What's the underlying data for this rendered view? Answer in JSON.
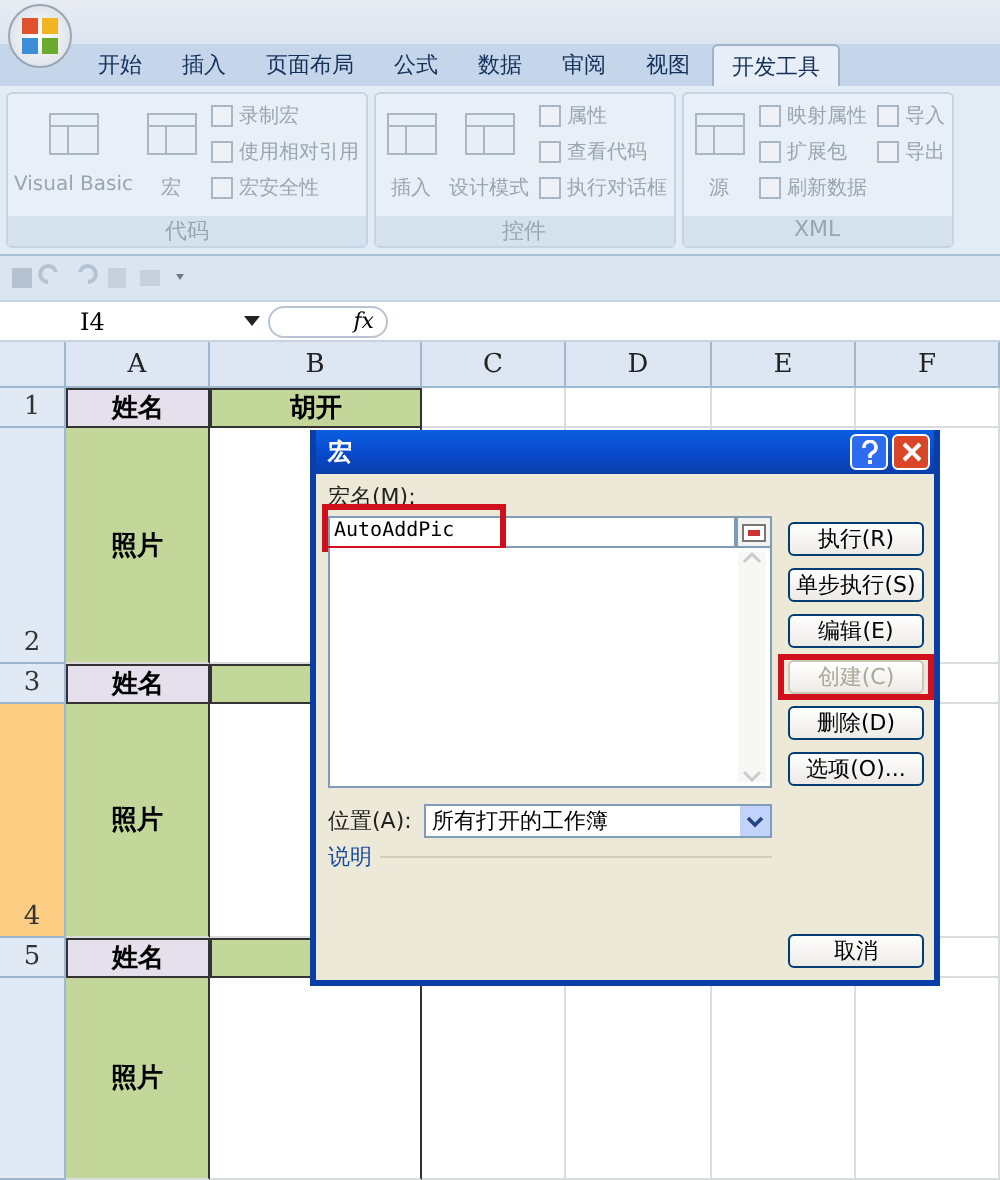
{
  "tabs": [
    {
      "label": "开始",
      "selected": false
    },
    {
      "label": "插入",
      "selected": false
    },
    {
      "label": "页面布局",
      "selected": false
    },
    {
      "label": "公式",
      "selected": false
    },
    {
      "label": "数据",
      "selected": false
    },
    {
      "label": "审阅",
      "selected": false
    },
    {
      "label": "视图",
      "selected": false
    },
    {
      "label": "开发工具",
      "selected": true
    }
  ],
  "ribbon": {
    "disabled": true,
    "groups": [
      {
        "title": "代码",
        "large": [
          "Visual Basic",
          "宏"
        ],
        "small": [
          [
            "录制宏",
            "使用相对引用",
            "宏安全性"
          ]
        ]
      },
      {
        "title": "控件",
        "large": [
          "插入",
          "设计模式"
        ],
        "small": [
          [
            "属性",
            "查看代码",
            "执行对话框"
          ]
        ]
      },
      {
        "title": "XML",
        "large": [
          "源"
        ],
        "small": [
          [
            "映射属性",
            "扩展包",
            "刷新数据"
          ],
          [
            "导入",
            "导出"
          ]
        ]
      }
    ]
  },
  "name_box": "I4",
  "formula_label": "fx",
  "columns": [
    "A",
    "B",
    "C",
    "D",
    "E",
    "F"
  ],
  "rows": [
    {
      "number": "1",
      "kind": "name",
      "selected": false,
      "cells": [
        "姓名",
        "胡开"
      ]
    },
    {
      "number": "2",
      "kind": "photo",
      "selected": false,
      "cells": [
        "照片"
      ]
    },
    {
      "number": "3",
      "kind": "name",
      "selected": false,
      "cells": [
        "姓名"
      ]
    },
    {
      "number": "4",
      "kind": "photo",
      "selected": true,
      "cells": [
        "照片"
      ]
    },
    {
      "number": "5",
      "kind": "name",
      "selected": false,
      "cells": [
        "姓名"
      ]
    },
    {
      "kind": "photo",
      "selected": false,
      "cells": [
        "照片"
      ]
    }
  ],
  "dialog": {
    "title": "宏",
    "name_label": "宏名(M):",
    "name_value": "AutoAddPic",
    "name_highlighted": true,
    "buttons": [
      {
        "label": "执行(R)",
        "disabled": false,
        "highlighted": false
      },
      {
        "label": "单步执行(S)",
        "disabled": false,
        "highlighted": false
      },
      {
        "label": "编辑(E)",
        "disabled": false,
        "highlighted": false
      },
      {
        "label": "创建(C)",
        "disabled": true,
        "highlighted": true
      },
      {
        "label": "删除(D)",
        "disabled": false,
        "highlighted": false
      },
      {
        "label": "选项(O)...",
        "disabled": false,
        "highlighted": false
      }
    ],
    "location_label": "位置(A):",
    "location_value": "所有打开的工作簿",
    "description_label": "说明",
    "cancel": "取消"
  }
}
